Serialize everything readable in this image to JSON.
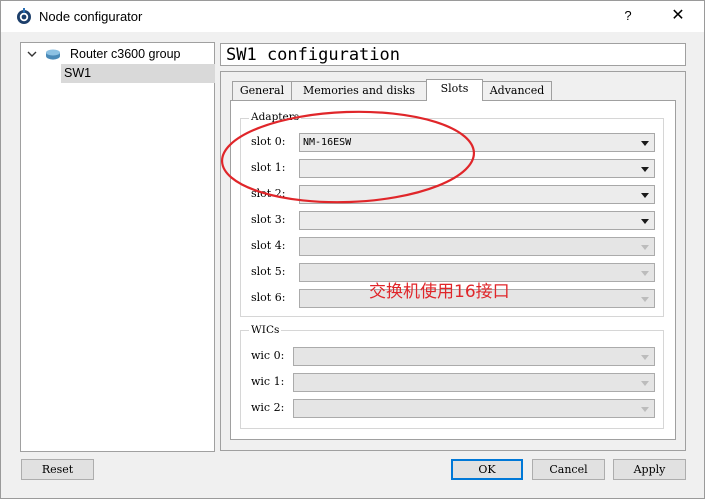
{
  "window": {
    "title": "Node configurator",
    "help_label": "?",
    "close_label": "✕"
  },
  "tree": {
    "group_label": "Router c3600 group",
    "selected_item": "SW1"
  },
  "header": {
    "title": "SW1 configuration"
  },
  "tabs": [
    {
      "label": "General"
    },
    {
      "label": "Memories and disks"
    },
    {
      "label": "Slots"
    },
    {
      "label": "Advanced"
    }
  ],
  "adapters": {
    "title": "Adapters",
    "slots": [
      {
        "label": "slot 0:",
        "value": "NM-16ESW"
      },
      {
        "label": "slot 1:",
        "value": ""
      },
      {
        "label": "slot 2:",
        "value": ""
      },
      {
        "label": "slot 3:",
        "value": ""
      },
      {
        "label": "slot 4:",
        "value": ""
      },
      {
        "label": "slot 5:",
        "value": ""
      },
      {
        "label": "slot 6:",
        "value": ""
      }
    ]
  },
  "wics": {
    "title": "WICs",
    "slots": [
      {
        "label": "wic 0:",
        "value": ""
      },
      {
        "label": "wic 1:",
        "value": ""
      },
      {
        "label": "wic 2:",
        "value": ""
      }
    ]
  },
  "annotation": {
    "text": "交换机使用16接口",
    "color": "#e0262a"
  },
  "buttons": {
    "reset": "Reset",
    "ok": "OK",
    "cancel": "Cancel",
    "apply": "Apply"
  },
  "colors": {
    "accent": "#0078d7",
    "selection": "#d9d9d9"
  }
}
